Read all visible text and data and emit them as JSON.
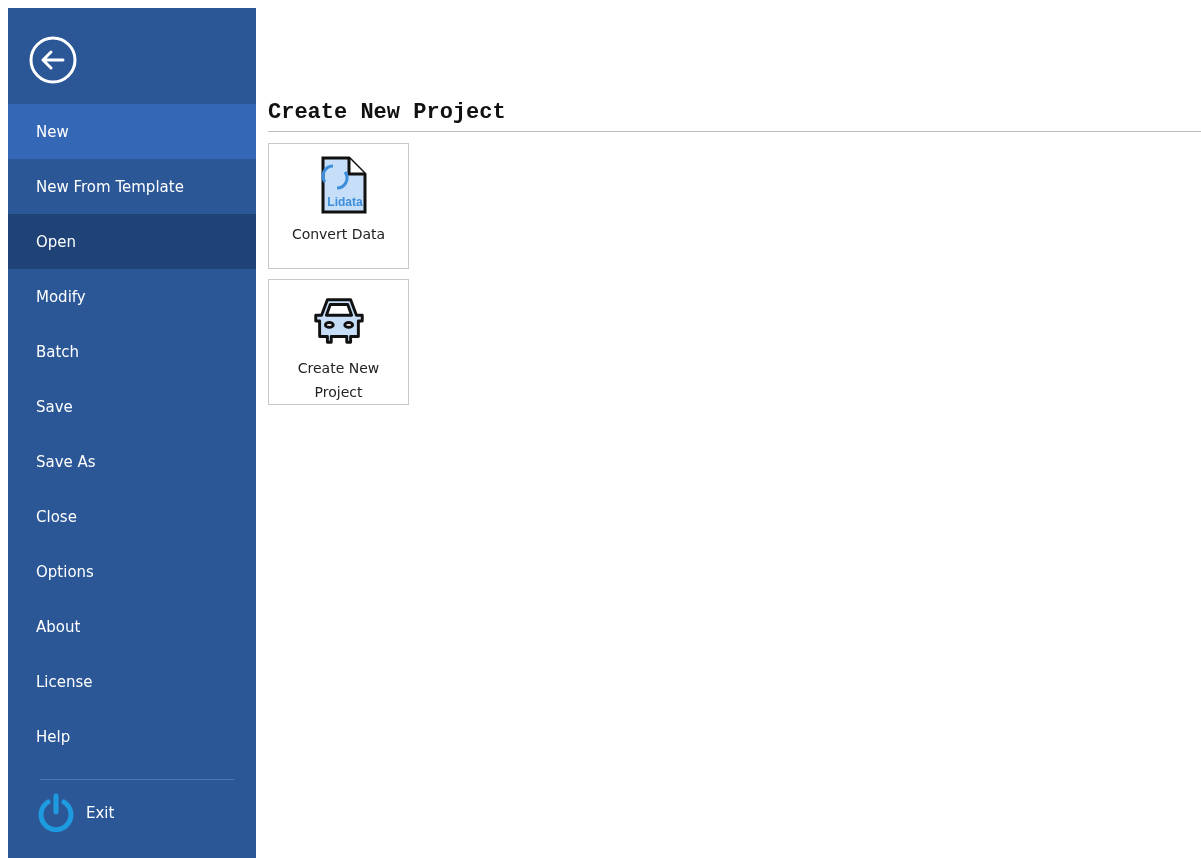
{
  "sidebar": {
    "items": [
      {
        "label": "New",
        "selected": true,
        "hovered": false
      },
      {
        "label": "New From Template",
        "selected": false,
        "hovered": false
      },
      {
        "label": "Open",
        "selected": false,
        "hovered": true
      },
      {
        "label": "Modify",
        "selected": false,
        "hovered": false
      },
      {
        "label": "Batch",
        "selected": false,
        "hovered": false
      },
      {
        "label": "Save",
        "selected": false,
        "hovered": false
      },
      {
        "label": "Save As",
        "selected": false,
        "hovered": false
      },
      {
        "label": "Close",
        "selected": false,
        "hovered": false
      },
      {
        "label": "Options",
        "selected": false,
        "hovered": false
      },
      {
        "label": "About",
        "selected": false,
        "hovered": false
      },
      {
        "label": "License",
        "selected": false,
        "hovered": false
      },
      {
        "label": "Help",
        "selected": false,
        "hovered": false
      }
    ],
    "exit": {
      "label": "Exit"
    }
  },
  "content": {
    "title": "Create New Project",
    "tiles": [
      {
        "kind": "convert",
        "label": "Convert Data",
        "badge": "Lidata"
      },
      {
        "kind": "car",
        "label": "Create New Project"
      }
    ]
  }
}
